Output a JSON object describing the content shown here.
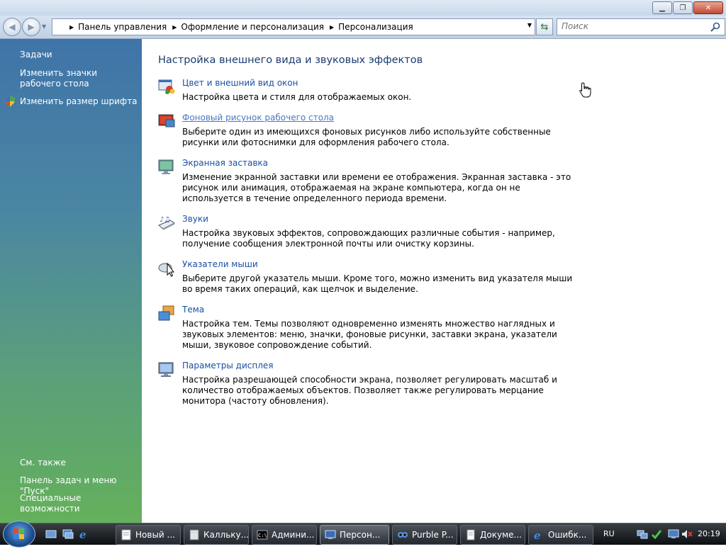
{
  "window": {
    "controls": {
      "minimize": "▭",
      "maximize": "▫",
      "close": "x"
    }
  },
  "nav": {
    "breadcrumbs": [
      "Панель управления",
      "Оформление и персонализация",
      "Персонализация"
    ],
    "search_placeholder": "Поиск"
  },
  "sidebar": {
    "tasks_heading": "Задачи",
    "task_items": [
      "Изменить значки рабочего стола",
      "Изменить размер шрифта"
    ],
    "see_also_heading": "См. также",
    "see_also_items": [
      "Панель задач и меню \"Пуск\"",
      "Специальные возможности"
    ]
  },
  "main": {
    "heading": "Настройка внешнего вида и звуковых эффектов",
    "items": [
      {
        "title": "Цвет и внешний вид окон",
        "icon": "window-color-icon",
        "desc": "Настройка цвета и стиля для отображаемых окон."
      },
      {
        "title": "Фоновый рисунок рабочего стола",
        "icon": "desktop-background-icon",
        "desc": "Выберите один из имеющихся фоновых рисунков либо используйте собственные рисунки или фотоснимки для оформления рабочего стола."
      },
      {
        "title": "Экранная заставка",
        "icon": "screensaver-icon",
        "desc": "Изменение экранной заставки или времени ее отображения. Экранная заставка - это рисунок или анимация, отображаемая на экране компьютера, когда он не используется в течение определенного периода времени."
      },
      {
        "title": "Звуки",
        "icon": "sounds-icon",
        "desc": "Настройка звуковых эффектов, сопровождающих различные события - например, получение сообщения электронной почты или очистку корзины."
      },
      {
        "title": "Указатели мыши",
        "icon": "mouse-pointer-icon",
        "desc": "Выберите другой указатель мыши. Кроме того, можно изменить вид указателя мыши во время таких операций, как щелчок и выделение."
      },
      {
        "title": "Тема",
        "icon": "theme-icon",
        "desc": "Настройка тем. Темы позволяют одновременно изменять множество наглядных и звуковых элементов: меню, значки, фоновые рисунки, заставки экрана, указатели мыши, звуковое сопровождение событий."
      },
      {
        "title": "Параметры дисплея",
        "icon": "display-settings-icon",
        "desc": "Настройка разрешающей способности экрана, позволяет регулировать масштаб и количество отображаемых объектов. Позволяет также регулировать мерцание монитора (частоту обновления)."
      }
    ]
  },
  "taskbar": {
    "tasks": [
      "Новый ...",
      "Калльку...",
      "Админи...",
      "Персон...",
      "Purble P...",
      "Докуме...",
      "Ошибк..."
    ],
    "lang": "RU",
    "clock": "20:19"
  }
}
